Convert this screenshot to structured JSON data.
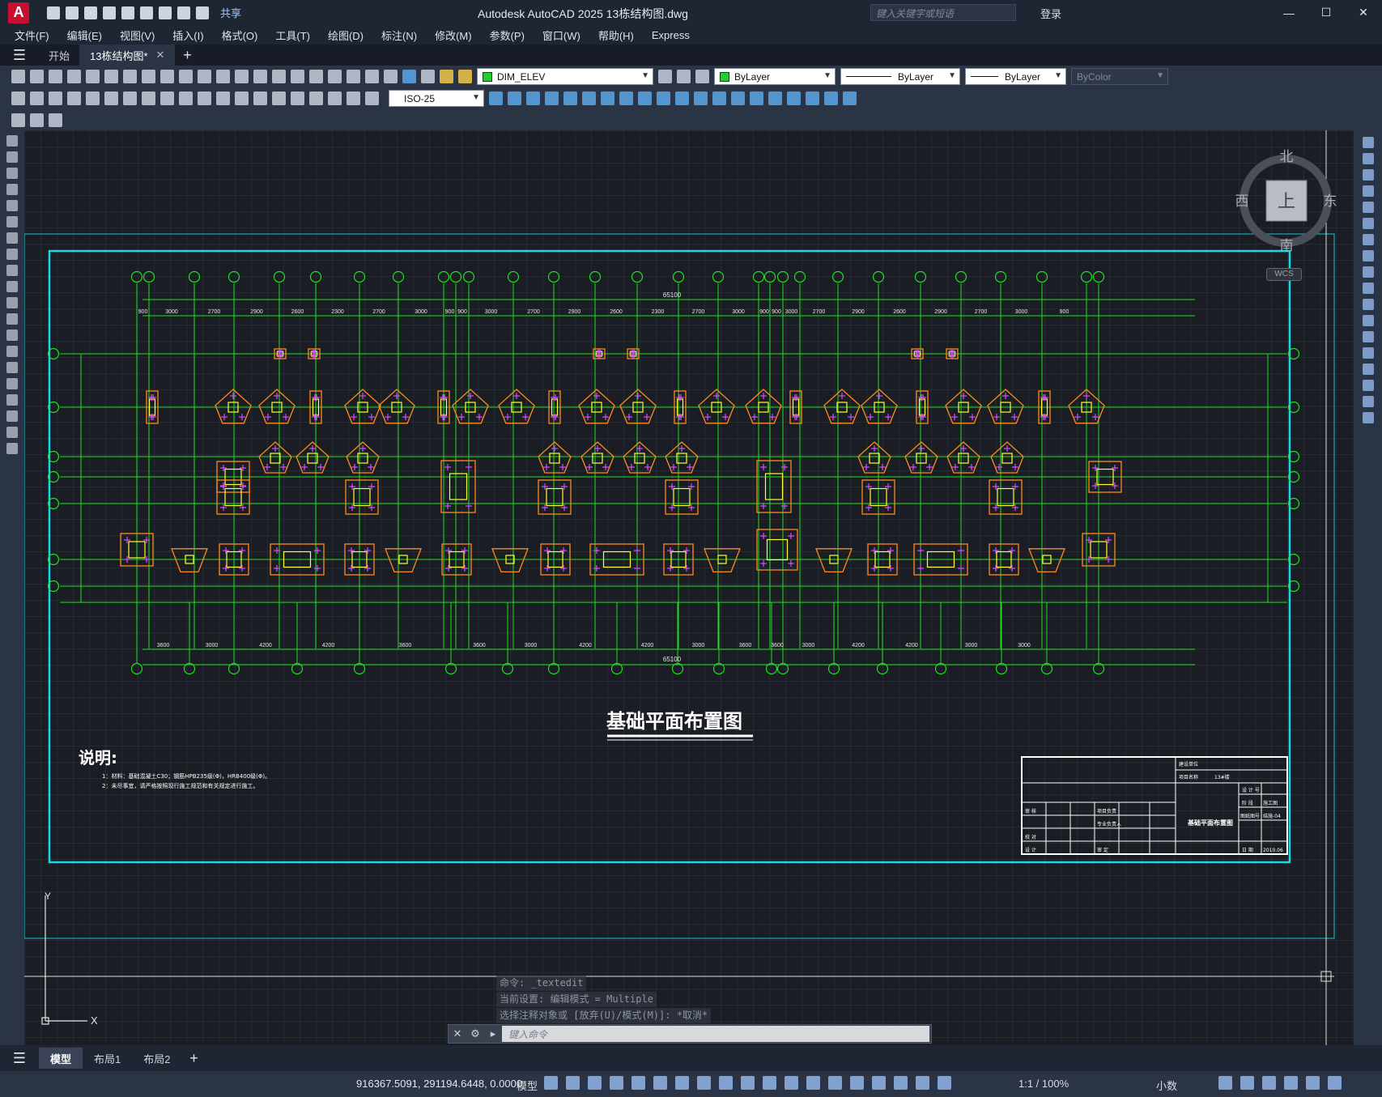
{
  "app": {
    "logo_letter": "A",
    "title": "Autodesk AutoCAD 2025    13栋结构图.dwg",
    "share_label": "共享",
    "search_placeholder": "键入关键字或短语",
    "login_label": "登录"
  },
  "menu": [
    "文件(F)",
    "编辑(E)",
    "视图(V)",
    "插入(I)",
    "格式(O)",
    "工具(T)",
    "绘图(D)",
    "标注(N)",
    "修改(M)",
    "参数(P)",
    "窗口(W)",
    "帮助(H)",
    "Express"
  ],
  "doc_tabs": {
    "start": "开始",
    "active": "13栋结构图*"
  },
  "toolbar": {
    "layer_name": "DIM_ELEV",
    "color": "ByLayer",
    "linetype": "ByLayer",
    "lineweight": "ByLayer",
    "plotstyle": "ByColor",
    "dim_style": "ISO-25",
    "layer_color_hex": "#22cc33"
  },
  "viewcube": {
    "north": "北",
    "south": "南",
    "east": "东",
    "west": "西",
    "face": "上",
    "wcs": "WCS"
  },
  "drawing": {
    "title": "基础平面布置图",
    "notes_heading": "说明:",
    "note_1": "1：材料：基础混凝土C30；钢筋HPB235级(Φ)，HRB400级(Φ)。",
    "note_2": "2：未尽事宜，请严格按照现行施工规范和有关规定进行施工。",
    "top_total": "65100",
    "bottom_total": "65100",
    "top_dims": [
      "900",
      "3000",
      "2700",
      "2900",
      "2600",
      "2300",
      "2700",
      "3000",
      "900",
      "900",
      "3000",
      "2700",
      "2900",
      "2600",
      "2300",
      "2700",
      "3000",
      "900",
      "900",
      "3000",
      "2700",
      "2900",
      "2600",
      "2900",
      "2700",
      "3000",
      "900"
    ],
    "bottom_dims": [
      "3600",
      "3000",
      "4200",
      "4200",
      "3600",
      "3600",
      "3000",
      "4200",
      "4200",
      "3000",
      "3600",
      "3600",
      "3000",
      "4200",
      "4200",
      "3000",
      "3000"
    ],
    "titleblock": {
      "owner": "建设单位",
      "project": "项目名称",
      "project_value": "13#楼",
      "drawing_name": "基础平面布置图",
      "stage": "施工图",
      "drawing_no": "结施-04",
      "date": "2010.06",
      "review": "审 核",
      "check": "校 对",
      "design": "设 计",
      "pm": "项目负责",
      "pro_lead": "专业负责人",
      "approve": "审 定",
      "design_no": "设 计 号",
      "phase": "阶 段",
      "drw_no_lbl": "图纸图号",
      "date_lbl": "日 期"
    }
  },
  "command": {
    "line1": "命令: _textedit",
    "line2": "当前设置: 编辑模式 = Multiple",
    "line3": "选择注释对象或 [放弃(U)/模式(M)]: *取消*",
    "input_placeholder": "键入命令"
  },
  "layouts": [
    "模型",
    "布局1",
    "布局2"
  ],
  "status": {
    "coords": "916367.5091, 291194.6448, 0.0000",
    "model": "模型",
    "scale": "1:1 / 100%",
    "units": "小数"
  }
}
